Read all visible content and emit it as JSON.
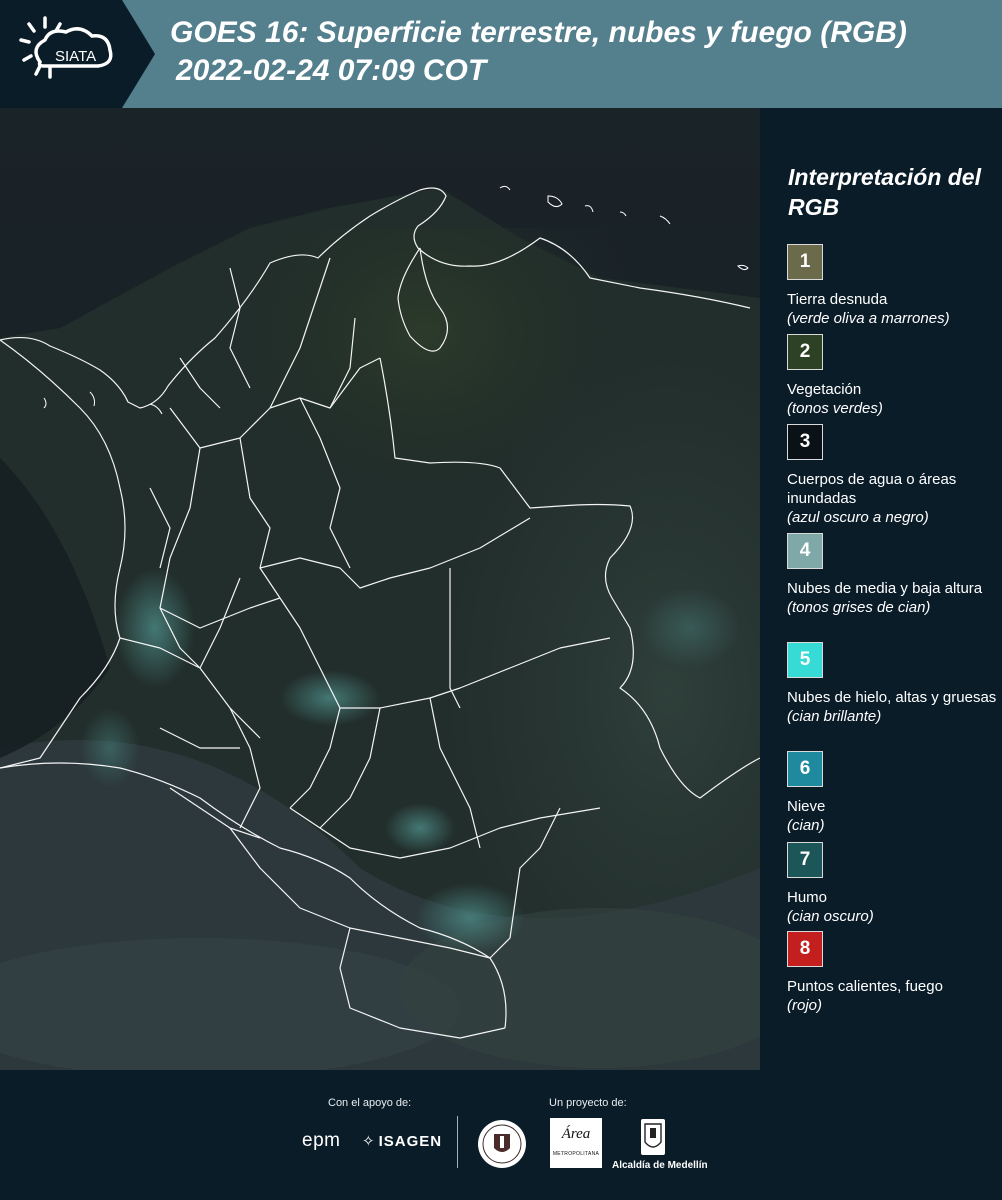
{
  "header": {
    "logo_text": "SIATA",
    "title_line1": "GOES 16: Superficie terrestre, nubes y fuego (RGB)",
    "title_line2": "2022-02-24 07:09 COT",
    "background_color": "#547f8d"
  },
  "map": {
    "description": "Imagen satelital RGB sobre Colombia con límites departamentales",
    "boundary_color": "#ffffff"
  },
  "legend": {
    "title": "Interpretación del RGB",
    "items": [
      {
        "number": "1",
        "label": "Tierra desnuda",
        "hint": "(verde oliva a marrones)",
        "color": "#6b6a4a"
      },
      {
        "number": "2",
        "label": "Vegetación",
        "hint": "(tonos verdes)",
        "color": "#2d4224"
      },
      {
        "number": "3",
        "label": "Cuerpos de agua o áreas inundadas",
        "hint": "(azul oscuro a negro)",
        "color": "#0a1218"
      },
      {
        "number": "4",
        "label": "Nubes de media y baja altura",
        "hint": "(tonos grises de cian)",
        "color": "#7fa9a8"
      },
      {
        "number": "5",
        "label": "Nubes de hielo, altas y gruesas",
        "hint": "(cian brillante)",
        "color": "#36dbd6"
      },
      {
        "number": "6",
        "label": "Nieve",
        "hint": "(cian)",
        "color": "#1f8a9e"
      },
      {
        "number": "7",
        "label": "Humo",
        "hint": "(cian oscuro)",
        "color": "#1c5658"
      },
      {
        "number": "8",
        "label": "Puntos calientes, fuego",
        "hint": "(rojo)",
        "color": "#c41f1f"
      }
    ]
  },
  "footer": {
    "support_caption": "Con el apoyo de:",
    "project_caption": "Un proyecto de:",
    "sponsor_epm": "epm",
    "sponsor_isagen": "ISAGEN",
    "amva_text": "Área",
    "amva_subtext": "METROPOLITANA",
    "medellin_label": "Alcaldía de Medellín"
  }
}
